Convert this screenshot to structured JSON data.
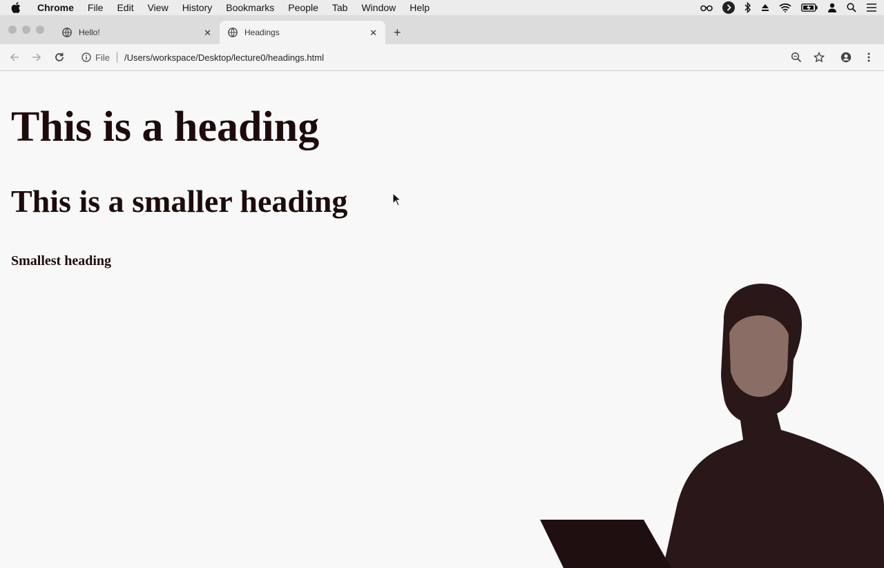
{
  "menubar": {
    "app": "Chrome",
    "items": [
      "File",
      "Edit",
      "View",
      "History",
      "Bookmarks",
      "People",
      "Tab",
      "Window",
      "Help"
    ]
  },
  "tabs": [
    {
      "title": "Hello!",
      "active": false
    },
    {
      "title": "Headings",
      "active": true
    }
  ],
  "toolbar": {
    "scheme_label": "File",
    "url": "/Users/workspace/Desktop/lecture0/headings.html"
  },
  "page": {
    "h1": "This is a heading",
    "h2": "This is a smaller heading",
    "h6": "Smallest heading"
  },
  "colors": {
    "text": "#1d0b0b",
    "background": "#f7f8f7",
    "tabstrip": "#dcdcdc",
    "toolbar": "#f4f4f4"
  },
  "icons": {
    "menubar_right": [
      "reader-glasses-icon",
      "play-circle-icon",
      "bluetooth-icon",
      "eject-icon",
      "wifi-icon",
      "battery-icon",
      "user-icon",
      "spotlight-search-icon",
      "list-icon"
    ]
  }
}
